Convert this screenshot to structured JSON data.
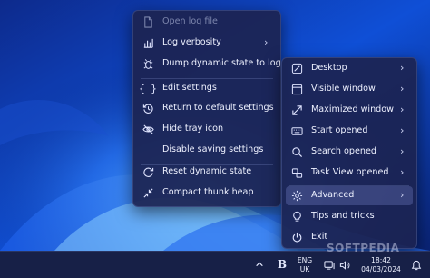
{
  "main_menu": {
    "items": [
      {
        "label": "Open log file",
        "icon": "document-icon",
        "disabled": true
      },
      {
        "label": "Log verbosity",
        "icon": "bar-chart-icon",
        "submenu": true
      },
      {
        "label": "Dump dynamic state to log",
        "icon": "bug-icon"
      },
      {
        "label": "Edit settings",
        "icon": "braces-icon"
      },
      {
        "label": "Return to default settings",
        "icon": "history-icon"
      },
      {
        "label": "Hide tray icon",
        "icon": "eye-off-icon"
      },
      {
        "label": "Disable saving settings",
        "icon": "none"
      },
      {
        "label": "Reset dynamic state",
        "icon": "reset-icon"
      },
      {
        "label": "Compact thunk heap",
        "icon": "compress-icon"
      }
    ]
  },
  "sub_menu": {
    "items": [
      {
        "label": "Desktop",
        "icon": "desktop-icon",
        "submenu": true
      },
      {
        "label": "Visible window",
        "icon": "window-icon",
        "submenu": true
      },
      {
        "label": "Maximized window",
        "icon": "maximize-icon",
        "submenu": true
      },
      {
        "label": "Start opened",
        "icon": "keyboard-icon",
        "submenu": true
      },
      {
        "label": "Search opened",
        "icon": "search-icon",
        "submenu": true
      },
      {
        "label": "Task View opened",
        "icon": "task-view-icon",
        "submenu": true
      },
      {
        "label": "Advanced",
        "icon": "gear-icon",
        "submenu": true,
        "highlighted": true
      },
      {
        "label": "Tips and tricks",
        "icon": "lightbulb-icon"
      },
      {
        "label": "Exit",
        "icon": "power-icon"
      }
    ]
  },
  "taskbar": {
    "language_line1": "ENG",
    "language_line2": "UK",
    "time": "18:42",
    "date": "04/03/2024",
    "tray_app_letter": "B"
  },
  "watermark": "SOFTPEDIA",
  "colors": {
    "menu_bg": "#1c2452",
    "highlight": "#5d66a8",
    "text": "#eef1ff",
    "disabled_text": "#7d86ad"
  }
}
